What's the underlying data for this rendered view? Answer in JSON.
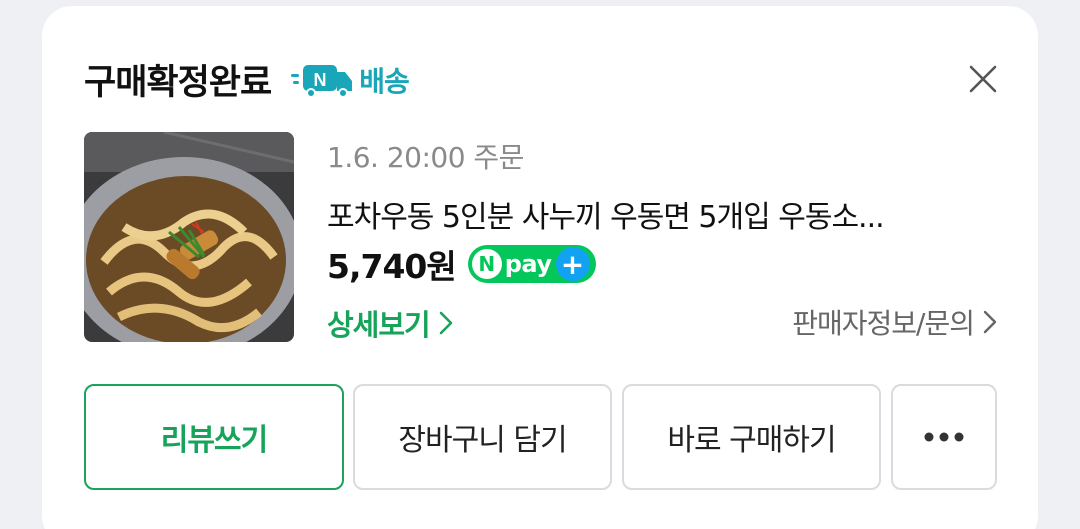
{
  "order": {
    "status_title": "구매확정완료",
    "delivery_label": "배송",
    "date": "1.6. 20:00 주문",
    "product_name": "포차우동 5인분 사누끼 우동면 5개입 우동소...",
    "price": "5,740원",
    "npay_text": "pay"
  },
  "links": {
    "details": "상세보기",
    "seller": "판매자정보/문의"
  },
  "buttons": {
    "review": "리뷰쓰기",
    "cart": "장바구니 담기",
    "buy": "바로 구매하기"
  },
  "colors": {
    "accent_green": "#17a35a",
    "npay_green": "#03c75a",
    "delivery_teal": "#19a6b8",
    "plus_blue": "#12a2f4"
  },
  "icons": [
    "delivery-truck-icon",
    "close-icon",
    "chevron-right-icon",
    "more-dots-icon"
  ]
}
